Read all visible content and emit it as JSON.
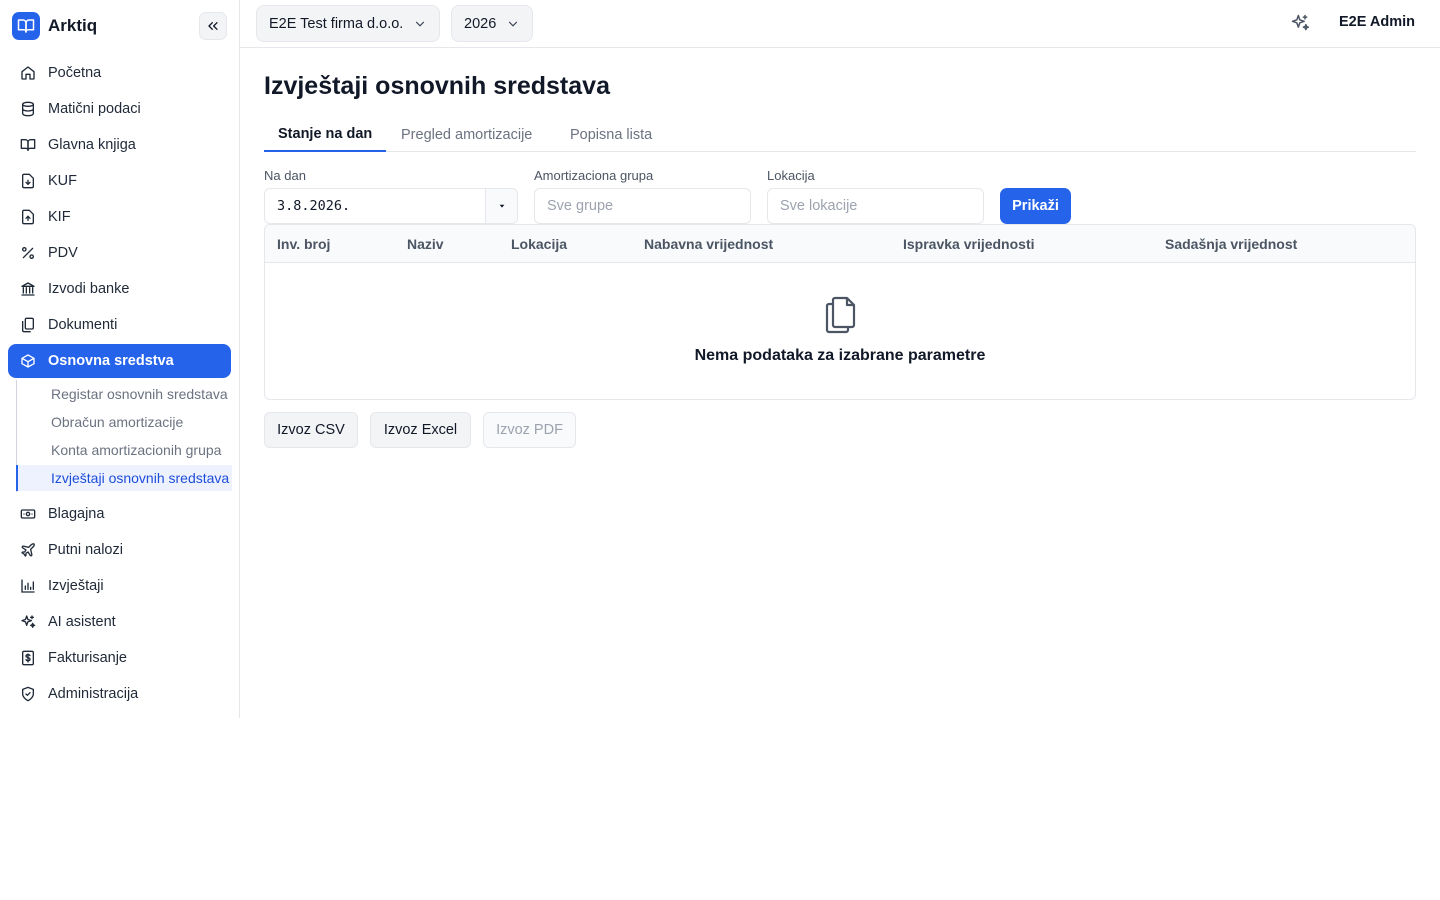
{
  "app": {
    "name": "Arktiq"
  },
  "sidebar": {
    "items": [
      {
        "label": "Početna",
        "icon": "home-icon"
      },
      {
        "label": "Matični podaci",
        "icon": "database-icon"
      },
      {
        "label": "Glavna knjiga",
        "icon": "book-open-icon"
      },
      {
        "label": "KUF",
        "icon": "file-download-icon"
      },
      {
        "label": "KIF",
        "icon": "file-upload-icon"
      },
      {
        "label": "PDV",
        "icon": "percent-icon"
      },
      {
        "label": "Izvodi banke",
        "icon": "bank-icon"
      },
      {
        "label": "Dokumenti",
        "icon": "documents-icon"
      },
      {
        "label": "Osnovna sredstva",
        "icon": "box-icon",
        "active": true
      },
      {
        "label": "Blagajna",
        "icon": "cash-icon"
      },
      {
        "label": "Putni nalozi",
        "icon": "plane-icon"
      },
      {
        "label": "Izvještaji",
        "icon": "bar-chart-icon"
      },
      {
        "label": "AI asistent",
        "icon": "sparkles-icon"
      },
      {
        "label": "Fakturisanje",
        "icon": "invoice-icon"
      },
      {
        "label": "Administracija",
        "icon": "shield-icon"
      }
    ],
    "subitems": [
      {
        "label": "Registar osnovnih sredstava"
      },
      {
        "label": "Obračun amortizacije"
      },
      {
        "label": "Konta amortizacionih grupa"
      },
      {
        "label": "Izvještaji osnovnih sredstava",
        "active": true
      }
    ]
  },
  "topbar": {
    "company": "E2E Test firma d.o.o.",
    "year": "2026",
    "user": "E2E Admin"
  },
  "page": {
    "title": "Izvještaji osnovnih sredstava",
    "tabs": [
      {
        "label": "Stanje na dan",
        "active": true
      },
      {
        "label": "Pregled amortizacije"
      },
      {
        "label": "Popisna lista"
      }
    ]
  },
  "filters": {
    "date_label": "Na dan",
    "date_value": "3.8.2026.",
    "group_label": "Amortizaciona grupa",
    "group_placeholder": "Sve grupe",
    "location_label": "Lokacija",
    "location_placeholder": "Sve lokacije",
    "submit_label": "Prikaži"
  },
  "table": {
    "columns": [
      "Inv. broj",
      "Naziv",
      "Lokacija",
      "Nabavna vrijednost",
      "Ispravka vrijednosti",
      "Sadašnja vrijednost"
    ],
    "rows": [],
    "empty_text": "Nema podataka za izabrane parametre"
  },
  "exports": {
    "csv": "Izvoz CSV",
    "excel": "Izvoz Excel",
    "pdf": "Izvoz PDF"
  },
  "colors": {
    "primary": "#2563eb",
    "border": "#e5e7eb",
    "muted": "#6b7280"
  }
}
